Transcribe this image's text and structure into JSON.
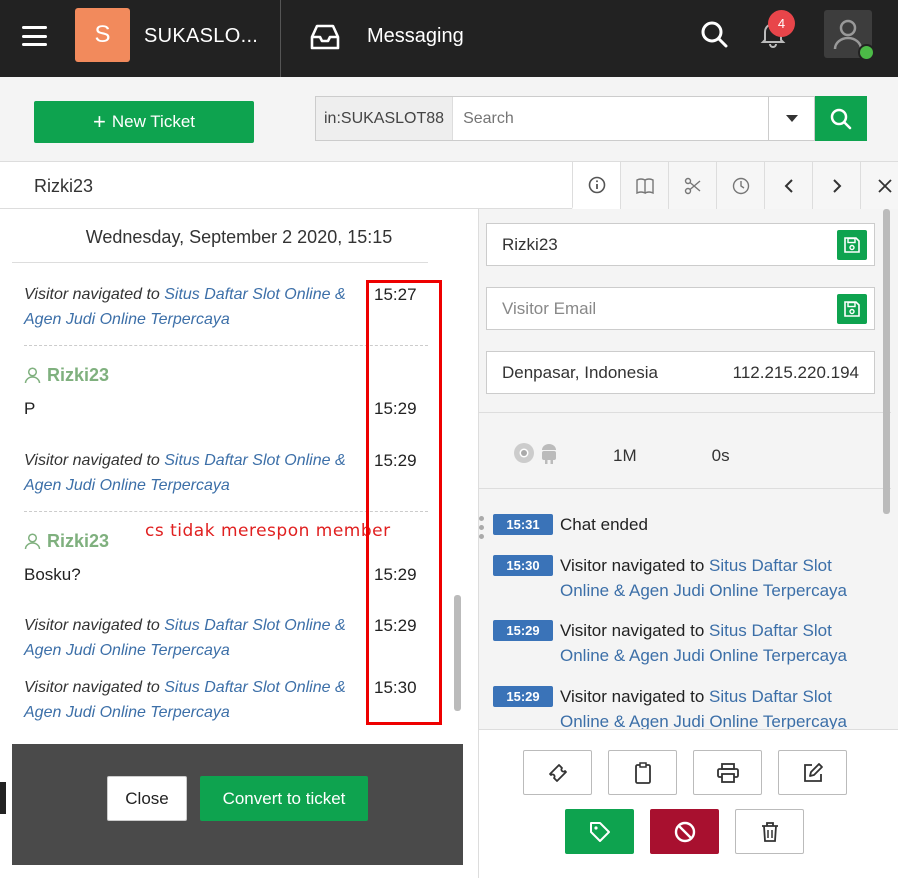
{
  "topbar": {
    "logo_letter": "S",
    "brand": "SUKASLO...",
    "app_title": "Messaging",
    "notification_count": "4"
  },
  "toolbar": {
    "new_ticket_icon": "+",
    "new_ticket_label": "New Ticket",
    "search_scope": "in:SUKASLOT88",
    "search_placeholder": "Search"
  },
  "conversation": {
    "name": "Rizki23",
    "date_header": "Wednesday, September 2 2020, 15:15",
    "link_text": "Situs Daftar Slot Online & Agen Judi Online Terpercaya",
    "nav_prefix": "Visitor navigated to ",
    "messages": [
      {
        "type": "nav",
        "time": "15:27"
      },
      {
        "type": "user",
        "user": "Rizki23"
      },
      {
        "type": "text",
        "text": "P",
        "time": "15:29"
      },
      {
        "type": "nav",
        "time": "15:29"
      },
      {
        "type": "user",
        "user": "Rizki23"
      },
      {
        "type": "text",
        "text": "Bosku?",
        "time": "15:29"
      },
      {
        "type": "nav",
        "time": "15:29"
      },
      {
        "type": "nav",
        "time": "15:30"
      }
    ],
    "annotation": "cs tidak merespon member",
    "close_label": "Close",
    "convert_label": "Convert to ticket"
  },
  "tabs": [
    "info-icon",
    "book-icon",
    "scissors-icon",
    "clock-icon",
    "chevron-left-icon",
    "chevron-right-icon",
    "close-icon"
  ],
  "visitor": {
    "name": "Rizki23",
    "email_placeholder": "Visitor Email",
    "location": "Denpasar, Indonesia",
    "ip": "112.215.220.194",
    "duration": "1M",
    "idle": "0s"
  },
  "events": [
    {
      "time": "15:31",
      "text": "Chat ended",
      "link": ""
    },
    {
      "time": "15:30",
      "text": "Visitor navigated to ",
      "link": "Situs Daftar Slot Online & Agen Judi Online Terpercaya"
    },
    {
      "time": "15:29",
      "text": "Visitor navigated to ",
      "link": "Situs Daftar Slot Online & Agen Judi Online Terpercaya"
    },
    {
      "time": "15:29",
      "text": "Visitor navigated to ",
      "link": "Situs Daftar Slot Online & Agen Judi Online Terpercaya"
    }
  ],
  "colors": {
    "primary_green": "#0ea34f",
    "danger_red": "#a8102f",
    "link_blue": "#3c6fa8",
    "annotation_red": "#ee0000"
  }
}
